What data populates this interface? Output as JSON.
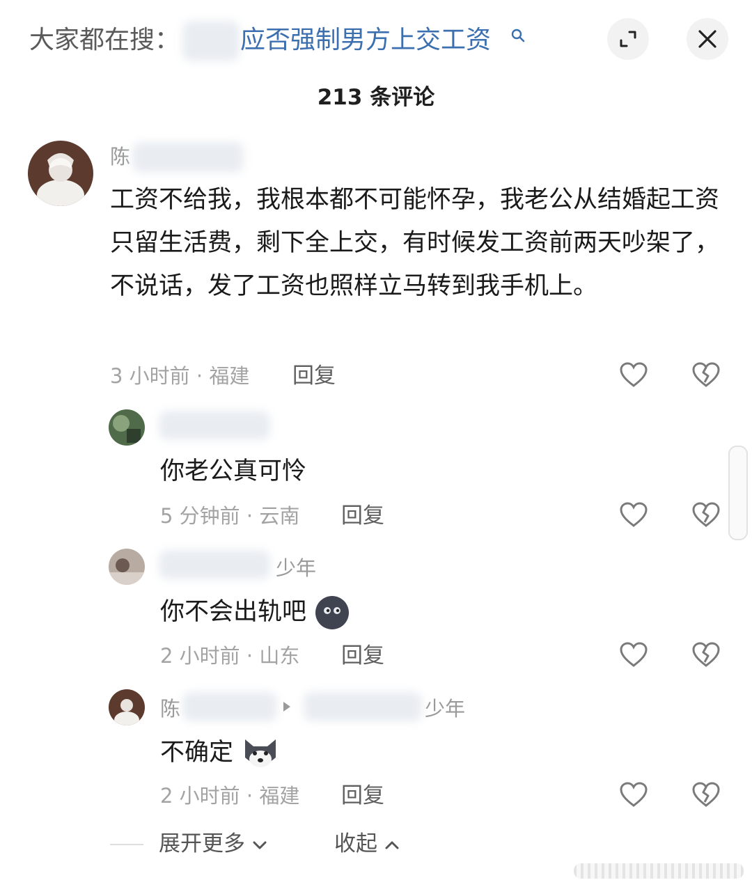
{
  "header": {
    "search_prefix": "大家都在搜：",
    "search_topic": "应否强制男方上交工资",
    "icons": {
      "search": "search-icon",
      "expand": "expand-icon",
      "close": "close-icon"
    }
  },
  "comment_count": "213 条评论",
  "comments": [
    {
      "username": "陈",
      "text": "工资不给我，我根本都不可能怀孕，我老公从结婚起工资只留生活费，剩下全上交，有时候发工资前两天吵架了，不说话，发了工资也照样立马转到我手机上。",
      "meta": "3 小时前 · 福建",
      "reply_label": "回复"
    }
  ],
  "replies": [
    {
      "username": "",
      "text": "你老公真可怜",
      "meta": "5 分钟前 · 云南",
      "reply_label": "回复"
    },
    {
      "username": "少年",
      "text": "你不会出轨吧",
      "emoji": "moon-face-emoji",
      "meta": "2 小时前 · 山东",
      "reply_label": "回复"
    },
    {
      "username": "陈",
      "reply_to": "少年",
      "text": "不确定",
      "emoji": "husky-dog-emoji",
      "meta": "2 小时前 · 福建",
      "reply_label": "回复"
    }
  ],
  "footer": {
    "expand_more": "展开更多",
    "collapse": "收起"
  },
  "colors": {
    "link": "#3b6fb0",
    "meta": "#a3a3a3",
    "text": "#1a1a1a"
  }
}
